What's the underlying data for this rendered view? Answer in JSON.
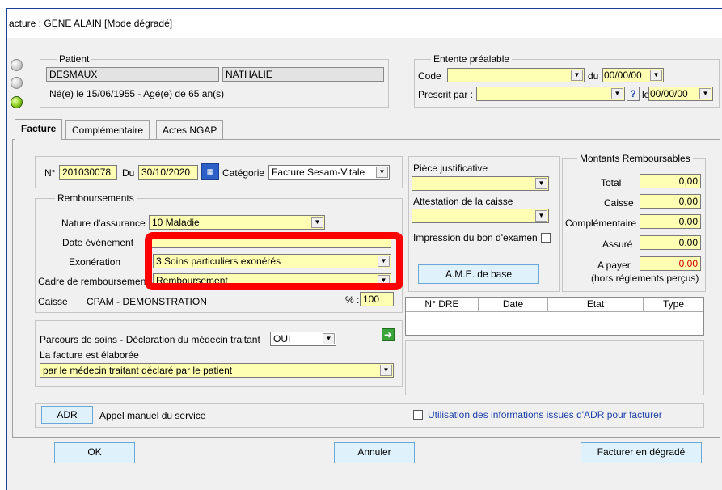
{
  "window": {
    "title": "acture : GENE ALAIN [Mode dégradé]"
  },
  "patient": {
    "legend": "Patient",
    "nom": "DESMAUX",
    "prenom": "NATHALIE",
    "naissance": "Né(e) le 15/06/1955 - Agé(e) de 65 an(s)"
  },
  "entente": {
    "legend": "Entente préalable",
    "code_label": "Code",
    "du_label": "du",
    "du_value": "00/00/00",
    "prescrit_label": "Prescrit par :",
    "help": "?",
    "le_label": "le",
    "le_value": "00/00/00"
  },
  "tabs": [
    {
      "label": "Facture",
      "active": true
    },
    {
      "label": "Complémentaire"
    },
    {
      "label": "Actes NGAP"
    }
  ],
  "facture": {
    "num_label": "N°",
    "num_value": "201030078",
    "du_label": "Du",
    "date_value": "30/10/2020",
    "calendar_icon": "calendar-icon",
    "categorie_label": "Catégorie",
    "categorie_value": "Facture Sesam-Vitale"
  },
  "remboursements": {
    "legend": "Remboursements",
    "nature_label": "Nature d'assurance",
    "nature_value": "10  Maladie",
    "date_evt_label": "Date évènement",
    "exo_label": "Exonération",
    "exo_value": "3  Soins particuliers exonérés",
    "cadre_label": "Cadre de remboursement",
    "cadre_value": "Remboursement",
    "caisse_label": "Caisse",
    "caisse_value": "CPAM - DEMONSTRATION",
    "pct_label": "% :",
    "pct_value": "100"
  },
  "parcours": {
    "label": "Parcours de soins - Déclaration du médecin traitant",
    "value": "OUI",
    "elab_label": "La facture est élaborée",
    "elab_value": "par le médecin traitant déclaré par le patient"
  },
  "pieces": {
    "piece_label": "Pièce justificative",
    "attestation_label": "Attestation de la caisse",
    "impression_label": "Impression du bon d'examen",
    "ame_button": "A.M.E. de base"
  },
  "montants": {
    "legend": "Montants Remboursables",
    "total_label": "Total",
    "total_value": "0,00",
    "caisse_label": "Caisse",
    "caisse_value": "0,00",
    "compl_label": "Complémentaire",
    "compl_value": "0,00",
    "assure_label": "Assuré",
    "assure_value": "0,00",
    "apayer_label": "A payer",
    "apayer_value": "0.00",
    "hors_label": "(hors réglements perçus)",
    "apayer_color": "#d40000"
  },
  "dre_table": {
    "columns": [
      "N° DRE",
      "Date",
      "Etat",
      "Type"
    ]
  },
  "adr": {
    "button": "ADR",
    "label": "Appel manuel du service",
    "checkbox_label": "Utilisation des informations issues d'ADR pour facturer"
  },
  "footer": {
    "ok": "OK",
    "annuler": "Annuler",
    "facturer": "Facturer en dégradé"
  },
  "colors": {
    "field_yellow": "#ffffb4",
    "annotation_red": "#ff0000",
    "button_blue": "#dff1fb"
  }
}
